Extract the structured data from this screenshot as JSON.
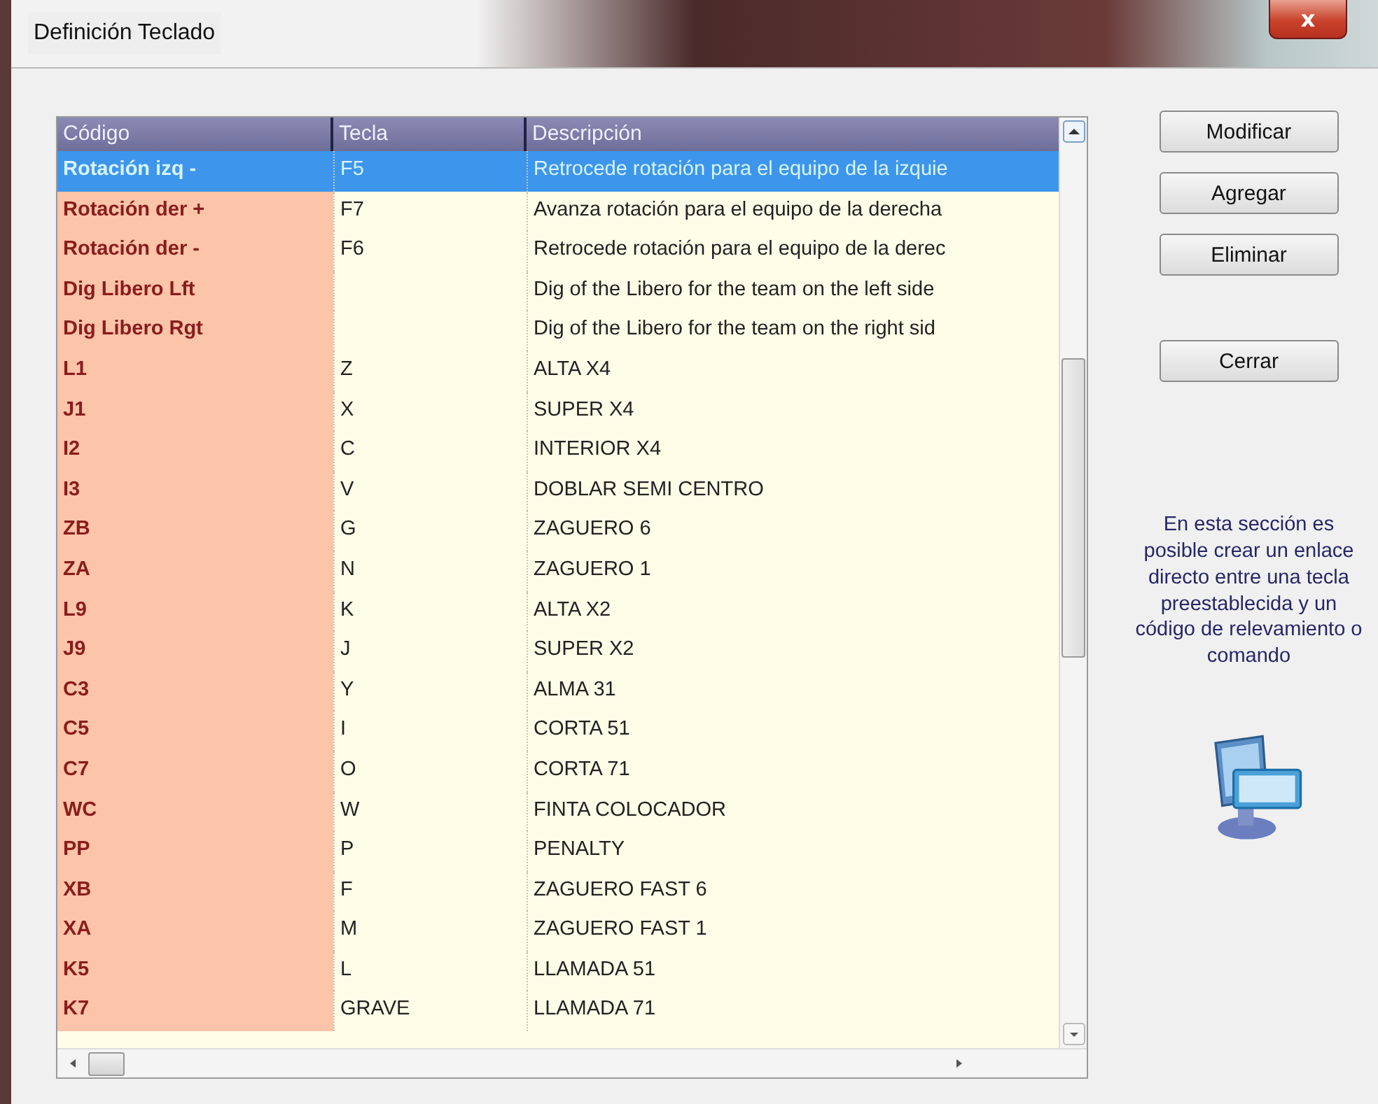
{
  "window": {
    "title": "Definición Teclado",
    "close": "x"
  },
  "table": {
    "columns": [
      "Código",
      "Tecla",
      "Descripción"
    ],
    "rows": [
      {
        "code": "Rotación izq -",
        "key": "F5",
        "description": "Retrocede rotación para el equipo de la izquie",
        "selected": true
      },
      {
        "code": "Rotación der +",
        "key": "F7",
        "description": "Avanza rotación para el equipo de la derecha",
        "selected": false
      },
      {
        "code": "Rotación der -",
        "key": "F6",
        "description": "Retrocede rotación para el equipo de la derec",
        "selected": false
      },
      {
        "code": "Dig Libero Lft",
        "key": "",
        "description": "Dig of the Libero for the team on the left side",
        "selected": false
      },
      {
        "code": "Dig Libero Rgt",
        "key": "",
        "description": "Dig of the Libero for the team on the right sid",
        "selected": false
      },
      {
        "code": "L1",
        "key": "Z",
        "description": "ALTA X4",
        "selected": false
      },
      {
        "code": "J1",
        "key": "X",
        "description": "SUPER X4",
        "selected": false
      },
      {
        "code": "I2",
        "key": "C",
        "description": "INTERIOR X4",
        "selected": false
      },
      {
        "code": "I3",
        "key": "V",
        "description": "DOBLAR SEMI CENTRO",
        "selected": false
      },
      {
        "code": "ZB",
        "key": "G",
        "description": "ZAGUERO 6",
        "selected": false
      },
      {
        "code": "ZA",
        "key": "N",
        "description": "ZAGUERO 1",
        "selected": false
      },
      {
        "code": "L9",
        "key": "K",
        "description": "ALTA X2",
        "selected": false
      },
      {
        "code": "J9",
        "key": "J",
        "description": "SUPER X2",
        "selected": false
      },
      {
        "code": "C3",
        "key": "Y",
        "description": "ALMA 31",
        "selected": false
      },
      {
        "code": "C5",
        "key": "I",
        "description": "CORTA 51",
        "selected": false
      },
      {
        "code": "C7",
        "key": "O",
        "description": "CORTA 71",
        "selected": false
      },
      {
        "code": "WC",
        "key": "W",
        "description": "FINTA COLOCADOR",
        "selected": false
      },
      {
        "code": "PP",
        "key": "P",
        "description": "PENALTY",
        "selected": false
      },
      {
        "code": "XB",
        "key": "F",
        "description": "ZAGUERO FAST 6",
        "selected": false
      },
      {
        "code": "XA",
        "key": "M",
        "description": "ZAGUERO FAST 1",
        "selected": false
      },
      {
        "code": "K5",
        "key": "L",
        "description": "LLAMADA 51",
        "selected": false
      },
      {
        "code": "K7",
        "key": "GRAVE",
        "description": "LLAMADA 71",
        "selected": false
      }
    ]
  },
  "buttons": [
    "Modificar",
    "Agregar",
    "Eliminar"
  ],
  "close_button": "Cerrar",
  "help_text": "En esta sección es posible crear un enlace directo entre una tecla preestablecida y un código de relevamiento o comando"
}
